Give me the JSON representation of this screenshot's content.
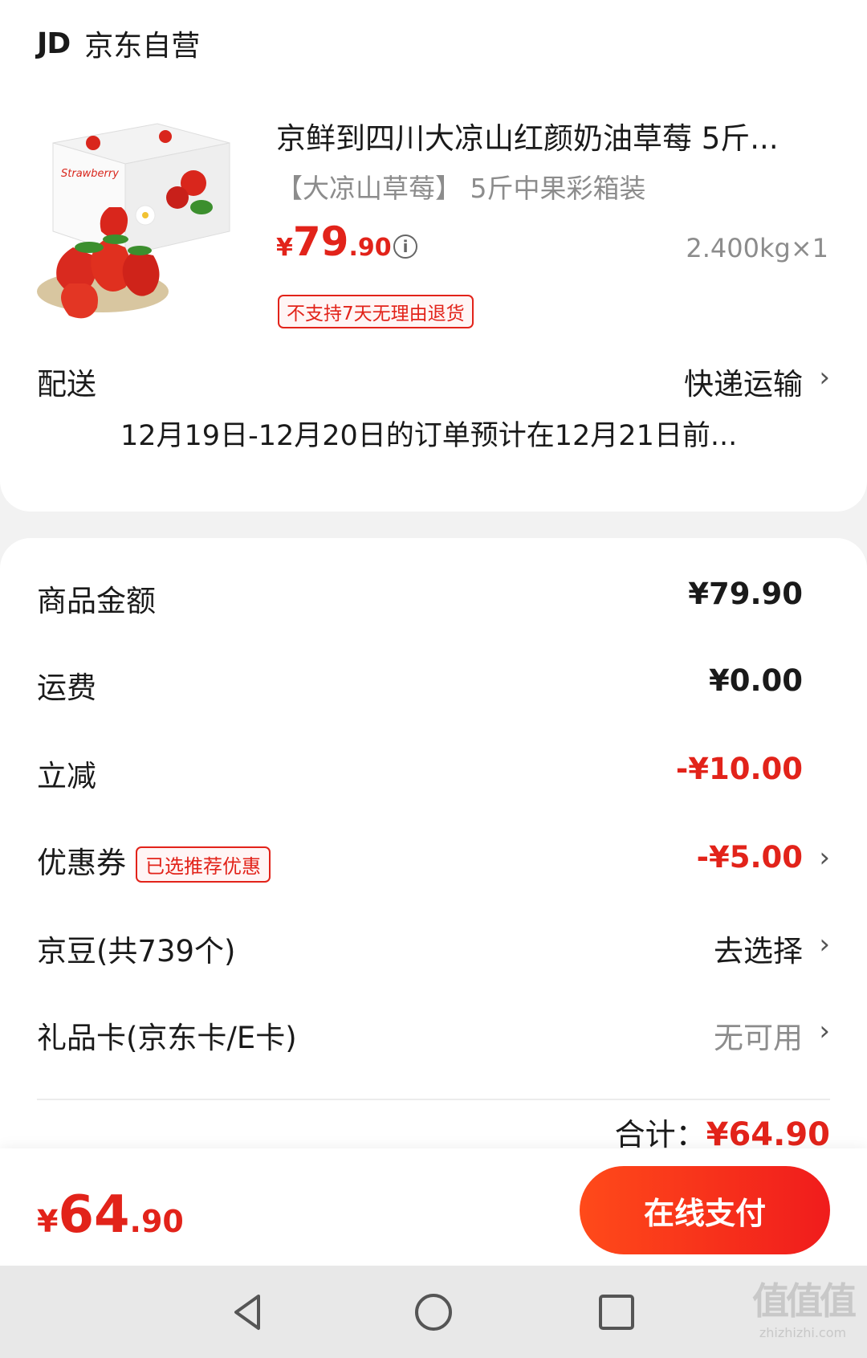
{
  "store": {
    "logo": "JD",
    "name": "京东自营"
  },
  "product": {
    "title": "京鲜到四川大凉山红颜奶油草莓 5斤...",
    "spec": "【大凉山草莓】 5斤中果彩箱装",
    "price_currency": "¥",
    "price_int": "79",
    "price_dec": ".90",
    "info_icon": "i",
    "weight": "2.400kg×1",
    "tag": "不支持7天无理由退货",
    "image_icon": "strawberry-box-image"
  },
  "delivery": {
    "label": "配送",
    "method": "快递运输",
    "note": "12月19日-12月20日的订单预计在12月21日前..."
  },
  "summary": {
    "goods_amount": {
      "label": "商品金额",
      "value": "¥79.90"
    },
    "shipping": {
      "label": "运费",
      "value": "¥0.00"
    },
    "discount": {
      "label": "立减",
      "value": "-¥10.00"
    },
    "coupon": {
      "label": "优惠券",
      "tag": "已选推荐优惠",
      "value": "-¥5.00"
    },
    "jd_beans": {
      "label": "京豆(共739个)",
      "value": "去选择"
    },
    "gift_card": {
      "label": "礼品卡(京东卡/E卡)",
      "value": "无可用"
    },
    "total_label": "合计：",
    "total_value": "¥64.90"
  },
  "bottom": {
    "currency": "¥",
    "int": "64",
    "dec": ".90",
    "pay_label": "在线支付"
  },
  "chevron": "›",
  "watermark": {
    "text": "值值值",
    "url": "zhizhizhi.com"
  },
  "colors": {
    "accent": "#e2231a",
    "pay_button": "#f4301a"
  }
}
